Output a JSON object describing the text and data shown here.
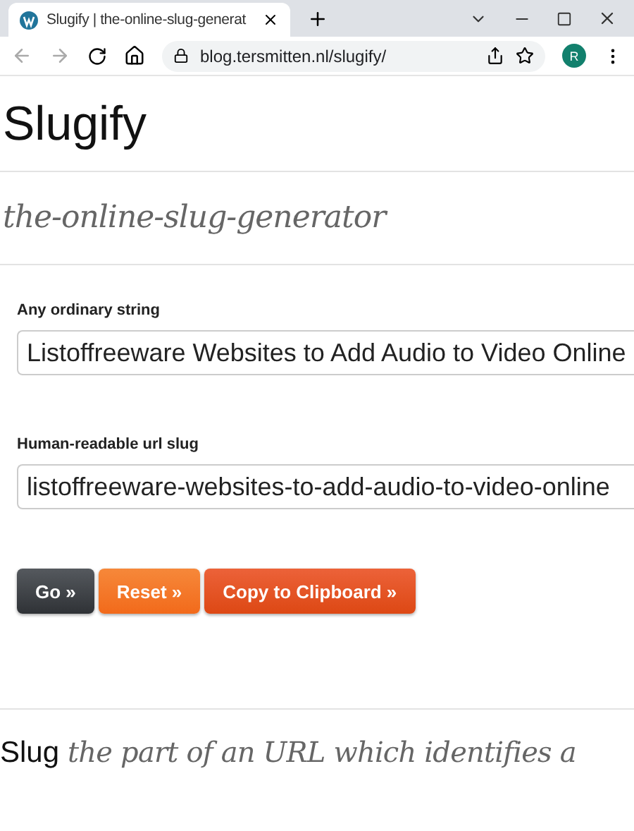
{
  "browser": {
    "tab": {
      "title": "Slugify | the-online-slug-generat",
      "selected": true
    },
    "url": "blog.tersmitten.nl/slugify/",
    "profile": "R"
  },
  "page": {
    "title": "Slugify",
    "subtitle": "the-online-slug-generator",
    "fields": [
      {
        "label": "Any ordinary string",
        "value": "Listoffreeware Websites to Add Audio to Video Online"
      },
      {
        "label": "Human-readable url slug",
        "value": "listoffreeware-websites-to-add-audio-to-video-online"
      }
    ],
    "buttons": [
      {
        "label": "Go »",
        "kind": "dark"
      },
      {
        "label": "Reset »",
        "kind": "orange"
      },
      {
        "label": "Copy to Clipboard »",
        "kind": "red"
      }
    ],
    "definition": {
      "term": "Slug",
      "text": "the part of an URL which identifies a"
    }
  }
}
